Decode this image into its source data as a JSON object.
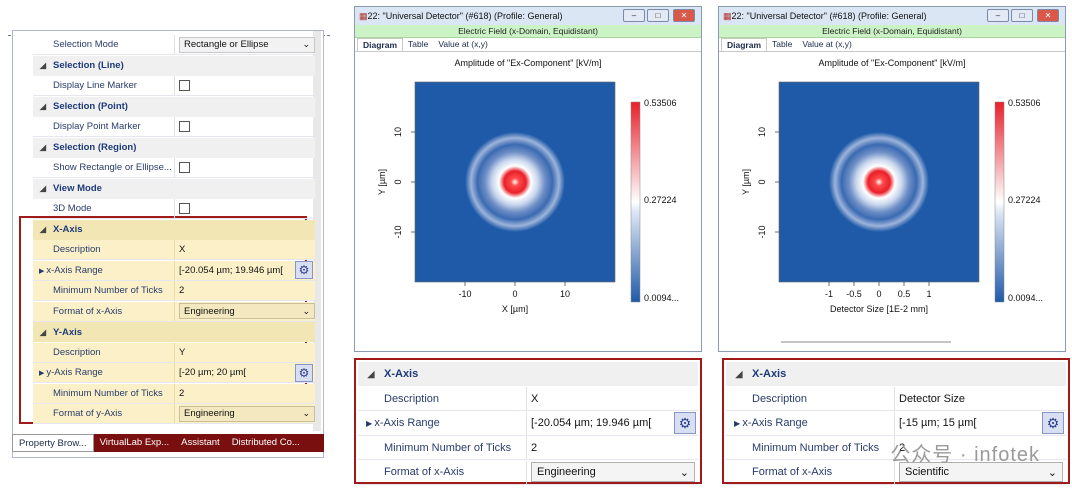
{
  "left_panel": {
    "rows": [
      {
        "kind": "row",
        "label": "Selection Mode",
        "value": "Rectangle or Ellipse",
        "control": "combo"
      },
      {
        "kind": "cat",
        "label": "Selection (Line)"
      },
      {
        "kind": "row",
        "label": "Display Line Marker",
        "control": "check"
      },
      {
        "kind": "cat",
        "label": "Selection (Point)"
      },
      {
        "kind": "row",
        "label": "Display Point Marker",
        "control": "check"
      },
      {
        "kind": "cat",
        "label": "Selection (Region)"
      },
      {
        "kind": "row",
        "label": "Show Rectangle or Ellipse...",
        "control": "check"
      },
      {
        "kind": "cat",
        "label": "View Mode"
      },
      {
        "kind": "row",
        "label": "3D Mode",
        "control": "check"
      },
      {
        "kind": "cat",
        "label": "X-Axis",
        "hl": true
      },
      {
        "kind": "row",
        "label": "Description",
        "value": "X",
        "hl": true
      },
      {
        "kind": "row",
        "label": "x-Axis Range",
        "value": "[-20.054 µm; 19.946 µm[",
        "control": "gear",
        "expand": true,
        "hl": true
      },
      {
        "kind": "row",
        "label": "Minimum Number of Ticks",
        "value": "2",
        "hl": true
      },
      {
        "kind": "row",
        "label": "Format of x-Axis",
        "value": "Engineering",
        "control": "combo",
        "hl": true
      },
      {
        "kind": "cat",
        "label": "Y-Axis",
        "hl": true
      },
      {
        "kind": "row",
        "label": "Description",
        "value": "Y",
        "hl": true
      },
      {
        "kind": "row",
        "label": "y-Axis Range",
        "value": "[-20 µm; 20 µm[",
        "control": "gear",
        "expand": true,
        "hl": true
      },
      {
        "kind": "row",
        "label": "Minimum Number of Ticks",
        "value": "2",
        "hl": true
      },
      {
        "kind": "row",
        "label": "Format of y-Axis",
        "value": "Engineering",
        "control": "combo",
        "hl": true
      }
    ],
    "tabs": [
      "Property Brow...",
      "VirtualLab Exp...",
      "Assistant",
      "Distributed Co..."
    ]
  },
  "windows": [
    {
      "title": "22: \"Universal Detector\" (#618) (Profile: General)",
      "subtitle": "Electric Field (x-Domain, Equidistant)",
      "tabs": [
        "Diagram",
        "Table",
        "Value at (x,y)"
      ],
      "plot_title": "Amplitude of \"Ex-Component\"  [kV/m]",
      "xlabel": "X [µm]",
      "ylabel": "Y [µm]",
      "xticks": [
        "-10",
        "0",
        "10"
      ],
      "yticks": [
        "10",
        "0",
        "-10"
      ],
      "cb_labels": [
        "0.53506",
        "0.27224",
        "0.0094..."
      ]
    },
    {
      "title": "22: \"Universal Detector\" (#618) (Profile: General)",
      "subtitle": "Electric Field (x-Domain, Equidistant)",
      "tabs": [
        "Diagram",
        "Table",
        "Value at (x,y)"
      ],
      "plot_title": "Amplitude of \"Ex-Component\"  [kV/m]",
      "xlabel": "Detector Size [1E-2 mm]",
      "ylabel": "Y [µm]",
      "xticks": [
        "-1",
        "-0.5",
        "0",
        "0.5",
        "1"
      ],
      "yticks": [
        "10",
        "0",
        "-10"
      ],
      "cb_labels": [
        "0.53506",
        "0.27224",
        "0.0094..."
      ]
    }
  ],
  "bottom_props": [
    {
      "header": "X-Axis",
      "description_label": "Description",
      "description": "X",
      "range_label": "x-Axis Range",
      "range": "[-20.054 µm; 19.946 µm[",
      "ticks_label": "Minimum Number of Ticks",
      "ticks": "2",
      "format_label": "Format of x-Axis",
      "format": "Engineering"
    },
    {
      "header": "X-Axis",
      "description_label": "Description",
      "description": "Detector Size",
      "range_label": "x-Axis Range",
      "range": "[-15 µm; 15 µm[",
      "ticks_label": "Minimum Number of Ticks",
      "ticks": "2",
      "format_label": "Format of x-Axis",
      "format": "Scientific"
    }
  ],
  "watermark": "公众号 · infotek",
  "colors": {
    "highlight_border": "#a01a1a",
    "plot_bg": "#1f5aa8",
    "peak": "#e8202a"
  }
}
